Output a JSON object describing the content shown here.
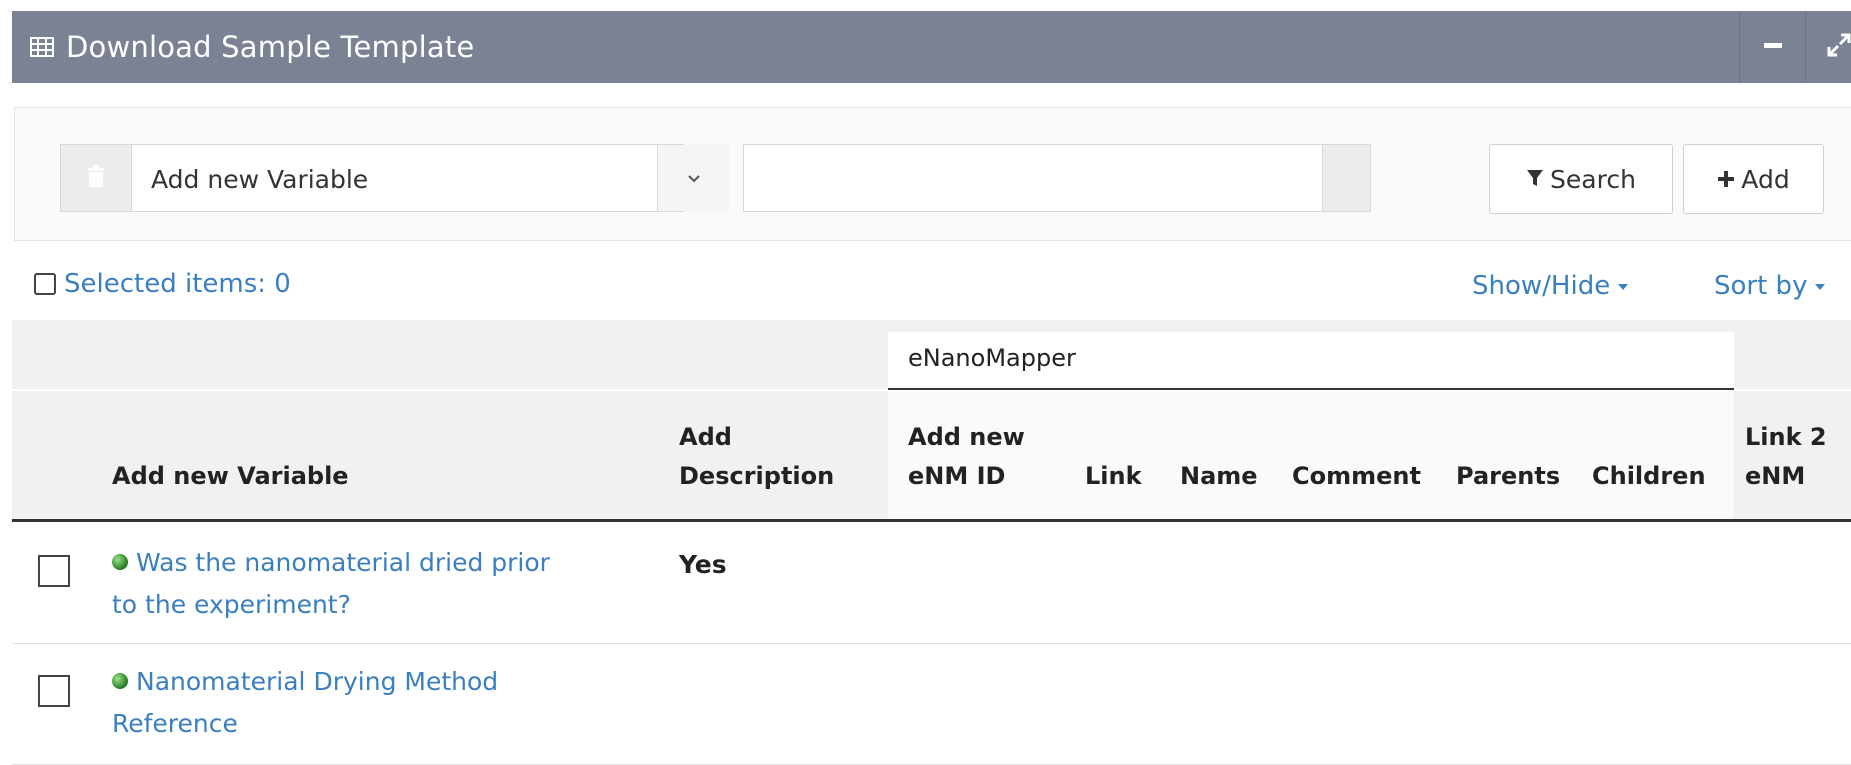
{
  "panel": {
    "title": "Download Sample Template"
  },
  "toolbar": {
    "select_value": "Add new Variable",
    "search_value": "",
    "search_label": "Search",
    "add_label": "Add"
  },
  "selection": {
    "label": "Selected items: 0"
  },
  "controls": {
    "show_hide": "Show/Hide",
    "sort_by": "Sort by"
  },
  "table": {
    "group_header": "eNanoMapper",
    "columns": {
      "variable": "Add new Variable",
      "description_1": "Add",
      "description_2": "Description",
      "enm_id_1": "Add new",
      "enm_id_2": "eNM ID",
      "link": "Link",
      "name": "Name",
      "comment": "Comment",
      "parents": "Parents",
      "children": "Children",
      "link2_1": "Link 2",
      "link2_2": "eNM"
    },
    "rows": [
      {
        "name_line1": "Was the nanomaterial dried prior",
        "name_line2": "to the experiment?",
        "description": "Yes"
      },
      {
        "name_line1": "Nanomaterial Drying Method",
        "name_line2": "Reference",
        "description": ""
      }
    ]
  }
}
